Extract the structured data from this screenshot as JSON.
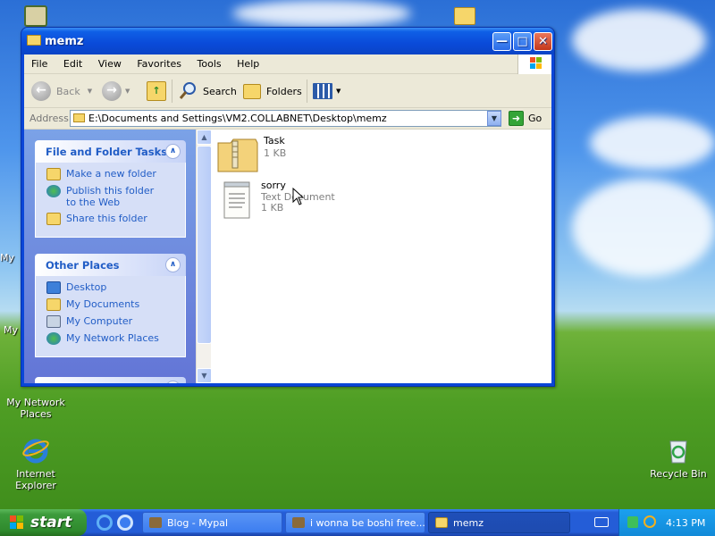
{
  "desktop": {
    "icons": [
      {
        "label": "My Network Places",
        "icon": "network-places-icon"
      },
      {
        "label": "Internet Explorer",
        "icon": "internet-explorer-icon"
      },
      {
        "label": "Recycle Bin",
        "icon": "recycle-bin-icon"
      }
    ],
    "partial_labels": [
      "My",
      "My"
    ]
  },
  "window": {
    "title": "memz",
    "menu": [
      "File",
      "Edit",
      "View",
      "Favorites",
      "Tools",
      "Help"
    ],
    "toolbar": {
      "back": "Back",
      "search": "Search",
      "folders": "Folders"
    },
    "address": {
      "label": "Address",
      "value": "E:\\Documents and Settings\\VM2.COLLABNET\\Desktop\\memz",
      "go": "Go"
    },
    "tasks": {
      "title": "File and Folder Tasks",
      "items": [
        "Make a new folder",
        "Publish this folder to the Web",
        "Share this folder"
      ]
    },
    "places": {
      "title": "Other Places",
      "items": [
        "Desktop",
        "My Documents",
        "My Computer",
        "My Network Places"
      ]
    },
    "files": [
      {
        "name": "Task",
        "type": "",
        "size": "1 KB",
        "icon": "zip-folder-icon"
      },
      {
        "name": "sorry",
        "type": "Text Document",
        "size": "1 KB",
        "icon": "text-document-icon"
      }
    ]
  },
  "taskbar": {
    "start": "start",
    "tasks": [
      {
        "label": "Blog - Mypal",
        "active": false
      },
      {
        "label": "i wonna be boshi free...",
        "active": false
      },
      {
        "label": "memz",
        "active": true
      }
    ],
    "clock": "4:13 PM"
  },
  "colors": {
    "accent": "#0a4ad9",
    "link": "#215dc6",
    "taskbar": "#245dd7",
    "start": "#3c9b3b"
  }
}
